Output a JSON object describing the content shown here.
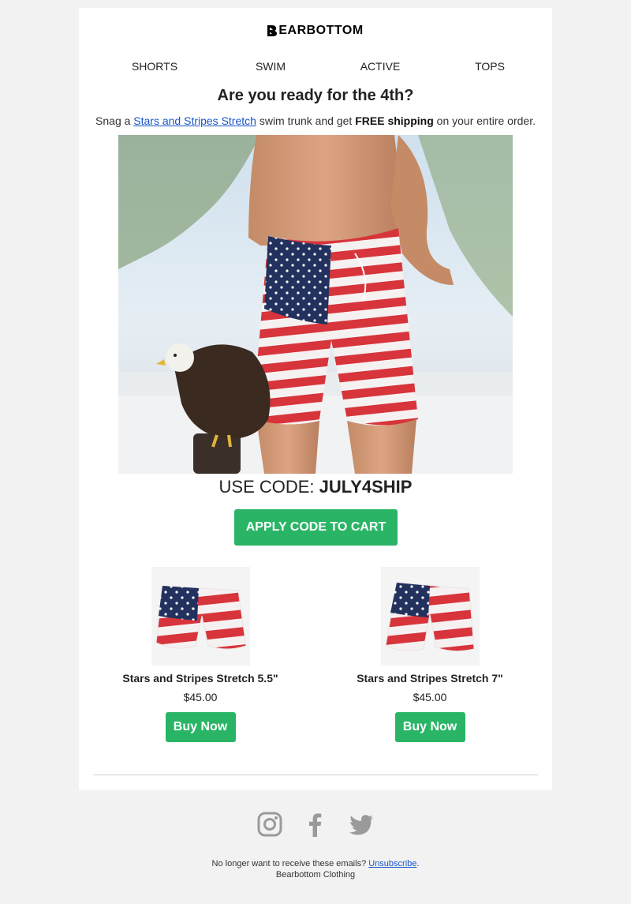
{
  "brand": {
    "logo_text": "EARBOTTOM",
    "logo_full": "BEARBOTTOM"
  },
  "nav": {
    "items": [
      {
        "label": "SHORTS"
      },
      {
        "label": "SWIM"
      },
      {
        "label": "ACTIVE"
      },
      {
        "label": "TOPS"
      }
    ]
  },
  "promo": {
    "headline": "Are you ready for the 4th?",
    "sub_prefix": "Snag a ",
    "sub_link": "Stars and Stripes Stretch",
    "sub_middle": " swim trunk and get ",
    "sub_bold": "FREE shipping",
    "sub_suffix": " on your entire order.",
    "code_label": "USE CODE: ",
    "code_value": "JULY4SHIP",
    "apply_label": "APPLY CODE TO CART"
  },
  "products": [
    {
      "name": "Stars and Stripes Stretch 5.5\"",
      "price": "$45.00",
      "cta": "Buy Now"
    },
    {
      "name": "Stars and Stripes Stretch 7\"",
      "price": "$45.00",
      "cta": "Buy Now"
    }
  ],
  "social": {
    "icons": [
      "instagram-icon",
      "facebook-icon",
      "twitter-icon"
    ],
    "color": "#9a9a9a"
  },
  "footer": {
    "unsub_prefix": "No longer want to receive these emails? ",
    "unsub_link": "Unsubscribe",
    "unsub_suffix": ".",
    "company": "Bearbottom Clothing"
  },
  "colors": {
    "accent": "#2ab566",
    "link": "#1a55c7",
    "background": "#f2f2f2"
  }
}
